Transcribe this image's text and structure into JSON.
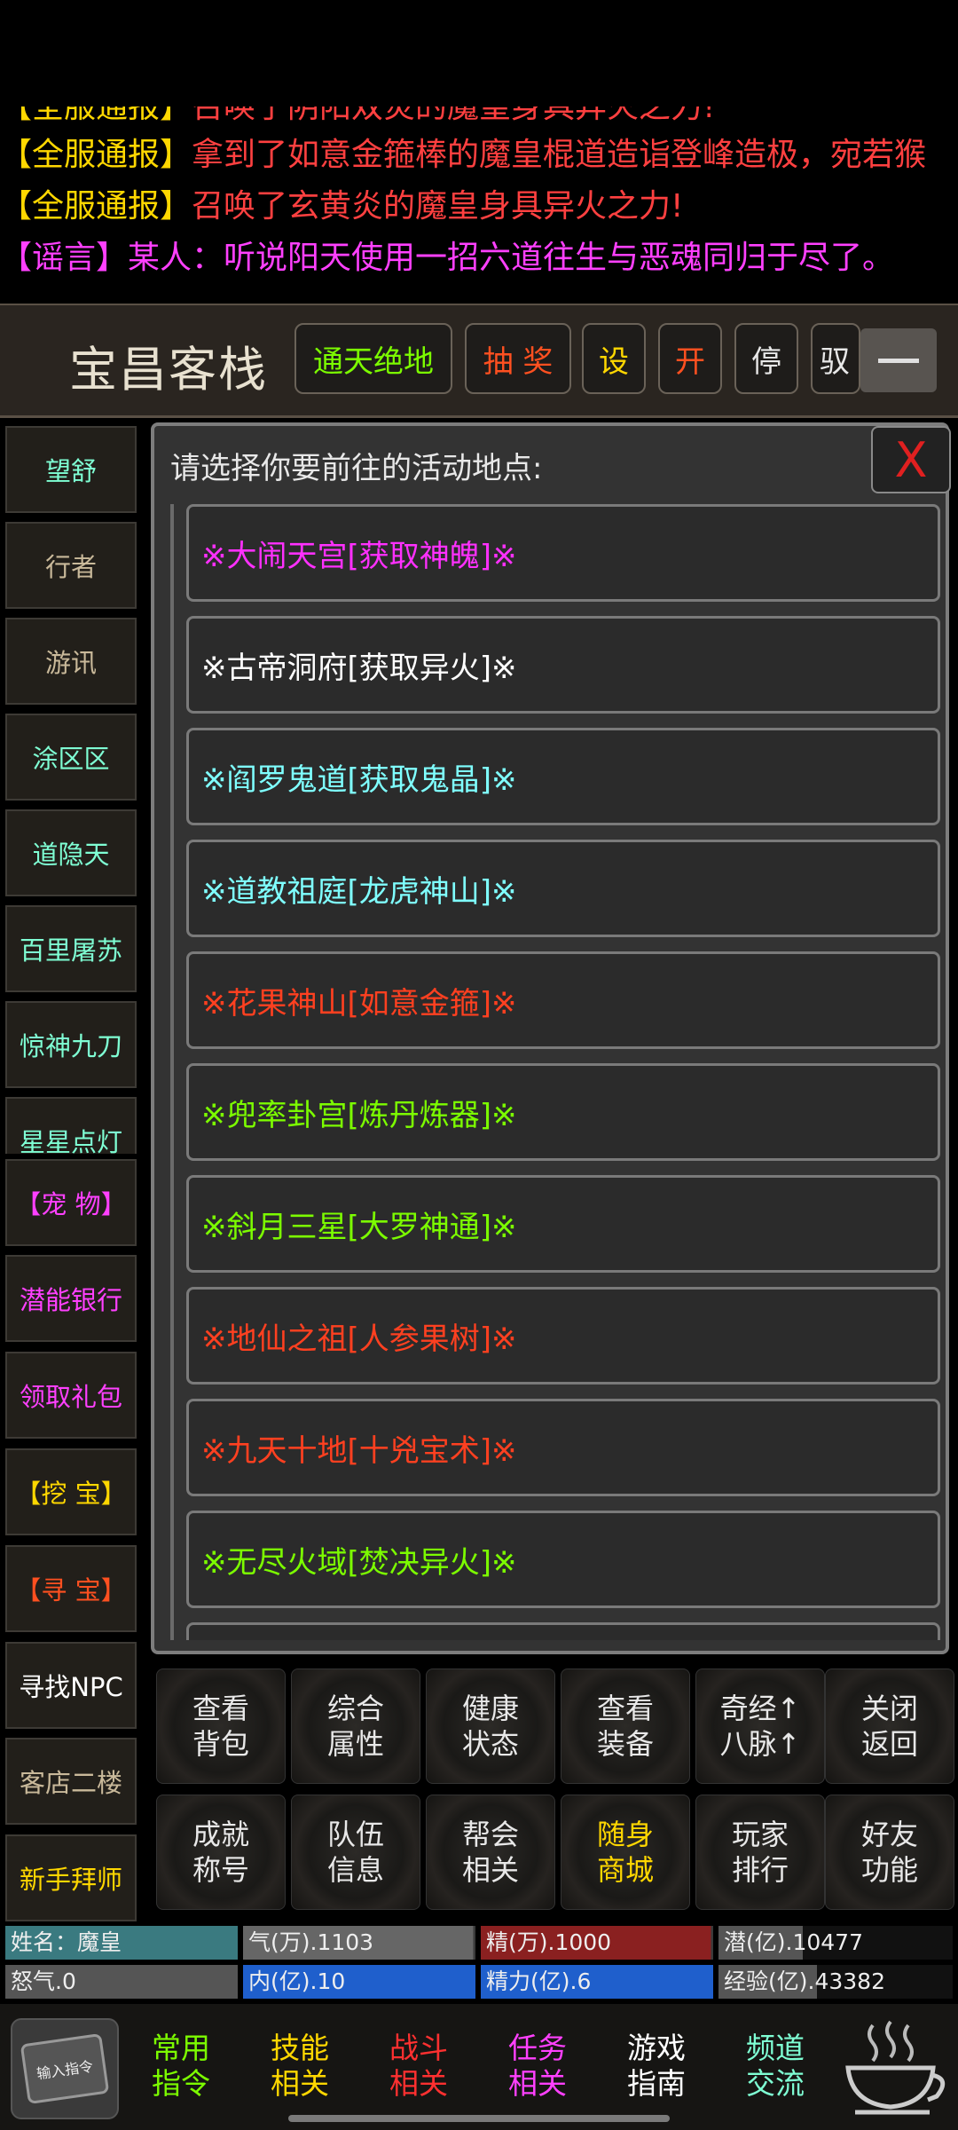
{
  "broadcast": [
    {
      "tag": "【全服通报】",
      "text": "召唤了阴阳双炎的魔皇身具异火之力!",
      "tag_color": "#ffd700",
      "color": "#ff4040"
    },
    {
      "tag": "【全服通报】",
      "text": "拿到了如意金箍棒的魔皇棍道造诣登峰造极，宛若猴",
      "tag_color": "#ffd700",
      "color": "#ff4040"
    },
    {
      "tag": "【全服通报】",
      "text": "召唤了玄黄炎的魔皇身具异火之力!",
      "tag_color": "#ffd700",
      "color": "#ff4040"
    },
    {
      "tag": "【谣言】",
      "text": "某人：听说阳天使用一招六道往生与恶魂同归于尽了。",
      "tag_color": "#ff40ff",
      "color": "#ff40ff"
    }
  ],
  "topbar": {
    "inn_name": "宝昌客栈",
    "buttons": [
      {
        "label": "通天绝地",
        "color": "#7cfc00"
      },
      {
        "label": "抽 奖",
        "color": "#ff5020"
      },
      {
        "label": "设",
        "color": "#ffd700"
      },
      {
        "label": "开",
        "color": "#ff5020"
      },
      {
        "label": "停",
        "color": "#e8e8e8"
      },
      {
        "label": "驭",
        "color": "#e8e8e8"
      }
    ]
  },
  "left_players": [
    {
      "label": "望舒",
      "color": "#7fffd4"
    },
    {
      "label": "行者",
      "color": "#c9b99a"
    },
    {
      "label": "游讯",
      "color": "#c9b99a"
    },
    {
      "label": "涂区区",
      "color": "#7fffd4"
    },
    {
      "label": "道隐天",
      "color": "#7fffd4"
    },
    {
      "label": "百里屠苏",
      "color": "#7fffd4"
    },
    {
      "label": "惊神九刀",
      "color": "#7fffd4"
    },
    {
      "label": "星星点灯",
      "color": "#7fffd4"
    }
  ],
  "left_functions": [
    {
      "label": "【宠 物】",
      "color": "#ff40ff"
    },
    {
      "label": "潜能银行",
      "color": "#ff40ff"
    },
    {
      "label": "领取礼包",
      "color": "#ff40ff"
    },
    {
      "label": "【挖 宝】",
      "color": "#ffd700"
    },
    {
      "label": "【寻 宝】",
      "color": "#ff5020"
    },
    {
      "label": "寻找NPC",
      "color": "#ffffff"
    },
    {
      "label": "客店二楼",
      "color": "#c9b99a"
    },
    {
      "label": "新手拜师",
      "color": "#ffd700"
    }
  ],
  "dialog": {
    "title": "请选择你要前往的活动地点:",
    "close_label": "X",
    "activities": [
      {
        "label": "※大闹天宫[获取神魄]※",
        "color": "#ff30ff"
      },
      {
        "label": "※古帝洞府[获取异火]※",
        "color": "#ffffff"
      },
      {
        "label": "※阎罗鬼道[获取鬼晶]※",
        "color": "#7fffff"
      },
      {
        "label": "※道教祖庭[龙虎神山]※",
        "color": "#7fffff"
      },
      {
        "label": "※花果神山[如意金箍]※",
        "color": "#ff4020"
      },
      {
        "label": "※兜率卦宫[炼丹炼器]※",
        "color": "#7cfc00"
      },
      {
        "label": "※斜月三星[大罗神通]※",
        "color": "#7cfc00"
      },
      {
        "label": "※地仙之祖[人参果树]※",
        "color": "#ff4020"
      },
      {
        "label": "※九天十地[十兇宝术]※",
        "color": "#ff4020"
      },
      {
        "label": "※无尽火域[焚决异火]※",
        "color": "#7cfc00"
      }
    ]
  },
  "grid_buttons": [
    {
      "l1": "查看",
      "l2": "背包",
      "color": "#e8e8e8"
    },
    {
      "l1": "综合",
      "l2": "属性",
      "color": "#e8e8e8"
    },
    {
      "l1": "健康",
      "l2": "状态",
      "color": "#e8e8e8"
    },
    {
      "l1": "查看",
      "l2": "装备",
      "color": "#e8e8e8"
    },
    {
      "l1": "奇经↑",
      "l2": "八脉↑",
      "color": "#e8e8e8"
    },
    {
      "l1": "关闭",
      "l2": "返回",
      "color": "#e8e8e8"
    },
    {
      "l1": "成就",
      "l2": "称号",
      "color": "#e8e8e8"
    },
    {
      "l1": "队伍",
      "l2": "信息",
      "color": "#e8e8e8"
    },
    {
      "l1": "帮会",
      "l2": "相关",
      "color": "#e8e8e8"
    },
    {
      "l1": "随身",
      "l2": "商城",
      "color": "#ffd700"
    },
    {
      "l1": "玩家",
      "l2": "排行",
      "color": "#e8e8e8"
    },
    {
      "l1": "好友",
      "l2": "功能",
      "color": "#e8e8e8"
    }
  ],
  "stats": [
    {
      "text": "姓名：魔皇",
      "fill": 1.0,
      "bar_color": "#3a7a80",
      "bg": "#3a3a3a"
    },
    {
      "text": "气(万).1103",
      "fill": 0.99,
      "bar_color": "#666666",
      "bg": "#3a3a3a"
    },
    {
      "text": "精(万).1000",
      "fill": 0.99,
      "bar_color": "#8a2020",
      "bg": "#3a3a3a"
    },
    {
      "text": "潜(亿).10477",
      "fill": 0.36,
      "bar_color": "#555555",
      "bg": "#111111"
    },
    {
      "text": "怒气.0",
      "fill": 1.0,
      "bar_color": "#555555",
      "bg": "#3a3a3a"
    },
    {
      "text": "内(亿).10",
      "fill": 1.0,
      "bar_color": "#1f5fcc",
      "bg": "#3a3a3a"
    },
    {
      "text": "精力(亿).6",
      "fill": 1.0,
      "bar_color": "#1f5fcc",
      "bg": "#3a3a3a"
    },
    {
      "text": "经验(亿).43382",
      "fill": 0.42,
      "bar_color": "#555555",
      "bg": "#111111"
    }
  ],
  "bottom_nav": {
    "input_label": "输入指令",
    "items": [
      {
        "l1": "常用",
        "l2": "指令",
        "color": "#7cfc00"
      },
      {
        "l1": "技能",
        "l2": "相关",
        "color": "#ffd700"
      },
      {
        "l1": "战斗",
        "l2": "相关",
        "color": "#ff3030"
      },
      {
        "l1": "任务",
        "l2": "相关",
        "color": "#ff40ff"
      },
      {
        "l1": "游戏",
        "l2": "指南",
        "color": "#ffffff"
      },
      {
        "l1": "频道",
        "l2": "交流",
        "color": "#7fffd4"
      }
    ]
  }
}
